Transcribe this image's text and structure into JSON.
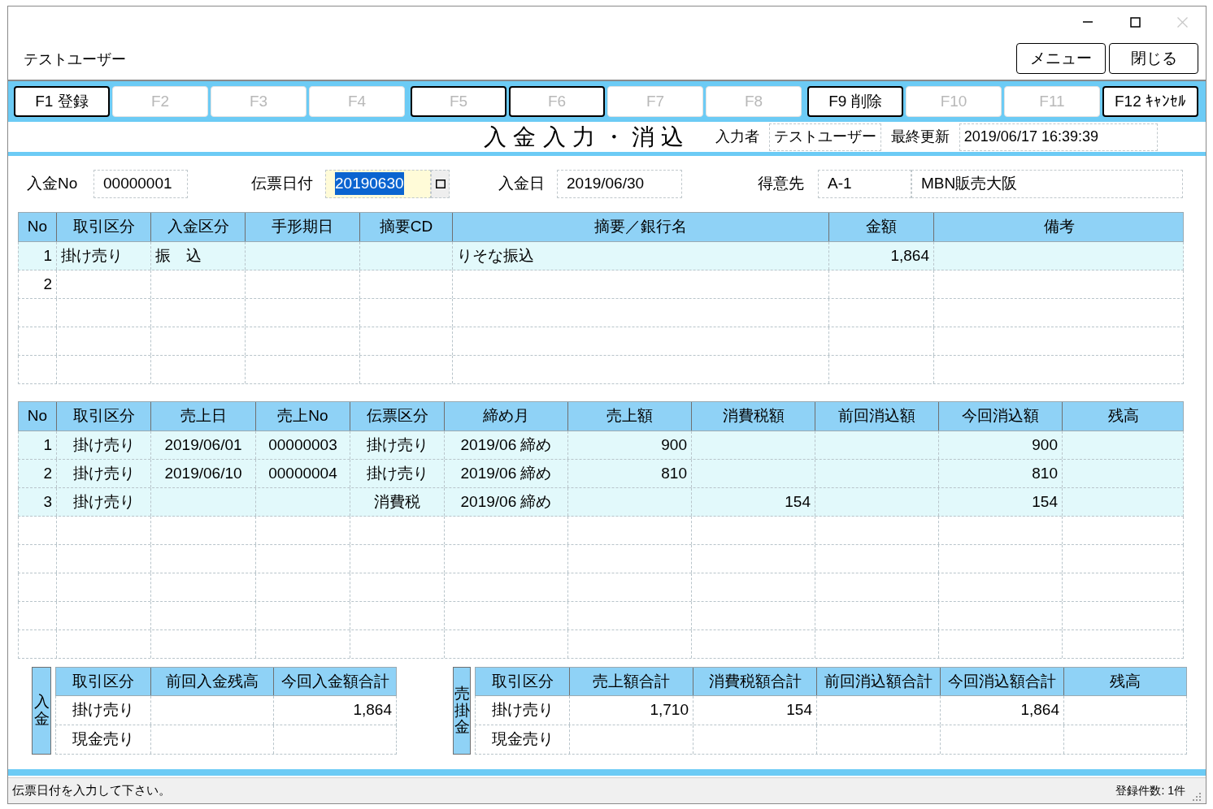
{
  "window": {
    "user": "テストユーザー",
    "controls": [
      {
        "kind": "minimize",
        "disabled": false
      },
      {
        "kind": "maximize",
        "disabled": false
      },
      {
        "kind": "close",
        "disabled": true
      }
    ]
  },
  "header_buttons": [
    "メニュー",
    "閉じる"
  ],
  "function_keys": [
    {
      "label": "F1 登録",
      "enabled": true,
      "outlined": true
    },
    {
      "label": "F2",
      "enabled": false,
      "outlined": false
    },
    {
      "label": "F3",
      "enabled": false,
      "outlined": false
    },
    {
      "label": "F4",
      "enabled": false,
      "outlined": false
    },
    {
      "label": "F5",
      "enabled": false,
      "outlined": true
    },
    {
      "label": "F6",
      "enabled": false,
      "outlined": true
    },
    {
      "label": "F7",
      "enabled": false,
      "outlined": false
    },
    {
      "label": "F8",
      "enabled": false,
      "outlined": false
    },
    {
      "label": "F9 削除",
      "enabled": true,
      "outlined": true
    },
    {
      "label": "F10",
      "enabled": false,
      "outlined": false
    },
    {
      "label": "F11",
      "enabled": false,
      "outlined": false
    },
    {
      "label": "F12 ｷｬﾝｾﾙ",
      "enabled": true,
      "outlined": true
    }
  ],
  "title": "入金入力・消込",
  "entered_by": {
    "label": "入力者",
    "value": "テストユーザー"
  },
  "last_updated": {
    "label": "最終更新",
    "value": "2019/06/17 16:39:39"
  },
  "form_fields": [
    {
      "kind": "text",
      "label": "入金No",
      "values": [
        "00000001"
      ],
      "focused": false
    },
    {
      "kind": "date",
      "label": "伝票日付",
      "values": [
        "20190630"
      ],
      "focused": true
    },
    {
      "kind": "text",
      "label": "入金日",
      "values": [
        "2019/06/30"
      ],
      "focused": false
    },
    {
      "kind": "text",
      "label": "得意先",
      "values": [
        "A-1",
        "MBN販売大阪"
      ],
      "focused": false
    }
  ],
  "payments_table": {
    "columns": [
      "No",
      "取引区分",
      "入金区分",
      "手形期日",
      "摘要CD",
      "摘要／銀行名",
      "金額",
      "備考"
    ],
    "rows": [
      {
        "highlighted": true,
        "cells": [
          "1",
          "掛け売り",
          "振　込",
          null,
          null,
          "りそな振込",
          "1,864",
          null
        ]
      },
      {
        "highlighted": false,
        "cells": [
          "2",
          null,
          null,
          null,
          null,
          null,
          null,
          null
        ]
      }
    ]
  },
  "sales_table": {
    "columns": [
      "No",
      "取引区分",
      "売上日",
      "売上No",
      "伝票区分",
      "締め月",
      "売上額",
      "消費税額",
      "前回消込額",
      "今回消込額",
      "残高"
    ],
    "rows": [
      {
        "highlighted": true,
        "cells": [
          "1",
          "掛け売り",
          "2019/06/01",
          "00000003",
          "掛け売り",
          "2019/06 締め",
          "900",
          null,
          null,
          "900",
          null
        ]
      },
      {
        "highlighted": true,
        "cells": [
          "2",
          "掛け売り",
          "2019/06/10",
          "00000004",
          "掛け売り",
          "2019/06 締め",
          "810",
          null,
          null,
          "810",
          null
        ]
      },
      {
        "highlighted": true,
        "cells": [
          "3",
          "掛け売り",
          null,
          null,
          "消費税",
          "2019/06 締め",
          null,
          "154",
          null,
          "154",
          null
        ]
      }
    ]
  },
  "deposit_summary": {
    "side_label": "入金",
    "columns": [
      "取引区分",
      "前回入金残高",
      "今回入金額合計"
    ],
    "rows": [
      [
        "掛け売り",
        null,
        "1,864"
      ],
      [
        "現金売り",
        null,
        null
      ]
    ]
  },
  "receivable_summary": {
    "side_label": "売掛金",
    "columns": [
      "取引区分",
      "売上額合計",
      "消費税額合計",
      "前回消込額合計",
      "今回消込額合計",
      "残高"
    ],
    "rows": [
      [
        "掛け売り",
        "1,710",
        "154",
        null,
        "1,864",
        null
      ],
      [
        "現金売り",
        null,
        null,
        null,
        null,
        null
      ]
    ]
  },
  "status_bar": {
    "message": "伝票日付を入力して下さい。",
    "count": "登録件数: 1件"
  }
}
